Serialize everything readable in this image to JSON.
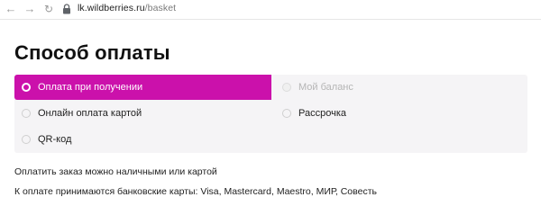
{
  "browser": {
    "url_host": "lk.wildberries.ru",
    "url_path": "/basket"
  },
  "page": {
    "title": "Способ оплаты"
  },
  "payment_options": [
    {
      "label": "Оплата при получении",
      "state": "selected"
    },
    {
      "label": "Онлайн оплата картой",
      "state": "unselected"
    },
    {
      "label": "QR-код",
      "state": "unselected"
    },
    {
      "label": "Мой баланс",
      "state": "disabled"
    },
    {
      "label": "Рассрочка",
      "state": "unselected"
    }
  ],
  "info": {
    "line1": "Оплатить заказ можно наличными или картой",
    "line2": "К оплате принимаются банковские карты: Visa, Mastercard, Maestro, МИР, Совесть"
  },
  "colors": {
    "accent": "#cb11ab",
    "options_background": "#f5f4f6"
  },
  "icons": [
    "arrow-left-icon",
    "arrow-right-icon",
    "reload-icon",
    "lock-icon"
  ]
}
